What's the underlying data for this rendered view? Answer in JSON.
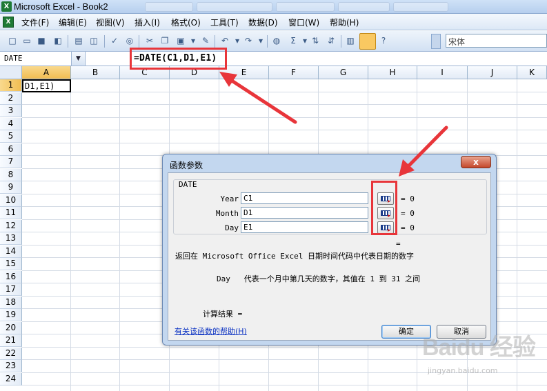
{
  "window": {
    "title": "Microsoft Excel - Book2",
    "app_icon": "excel-icon"
  },
  "menu": {
    "items": [
      "文件(F)",
      "编辑(E)",
      "视图(V)",
      "插入(I)",
      "格式(O)",
      "工具(T)",
      "数据(D)",
      "窗口(W)",
      "帮助(H)"
    ]
  },
  "toolbar": {
    "font_name": "宋体"
  },
  "formula_bar": {
    "name_box": "DATE",
    "formula": "=DATE(C1,D1,E1)"
  },
  "sheet": {
    "columns": [
      "A",
      "B",
      "C",
      "D",
      "E",
      "F",
      "G",
      "H",
      "I",
      "J",
      "K"
    ],
    "rows": [
      "1",
      "2",
      "3",
      "4",
      "5",
      "6",
      "7",
      "8",
      "9",
      "10",
      "11",
      "12",
      "13",
      "14",
      "15",
      "16",
      "17",
      "18",
      "19",
      "20",
      "21",
      "22",
      "23",
      "24"
    ],
    "active_column": "A",
    "active_row": "1",
    "a1_value": "D1,E1)"
  },
  "dialog": {
    "title": "函数参数",
    "close_label": "x",
    "function_name": "DATE",
    "args": [
      {
        "label": "Year",
        "value": "C1",
        "result": "= 0"
      },
      {
        "label": "Month",
        "value": "D1",
        "result": "= 0"
      },
      {
        "label": "Day",
        "value": "E1",
        "result": "= 0"
      }
    ],
    "formula_result": "=",
    "description": "返回在 Microsoft Office Excel 日期时间代码中代表日期的数字",
    "arg_help_name": "Day",
    "arg_help_text": "代表一个月中第几天的数字，其值在 1 到 31 之间",
    "calc_result_label": "计算结果 =",
    "help_link": "有关该函数的帮助(H)",
    "ok_label": "确定",
    "cancel_label": "取消"
  },
  "annotation_colors": {
    "highlight_red": "#e8353a"
  },
  "watermark": {
    "brand": "Baidu 经验",
    "url": "jingyan.baidu.com"
  }
}
